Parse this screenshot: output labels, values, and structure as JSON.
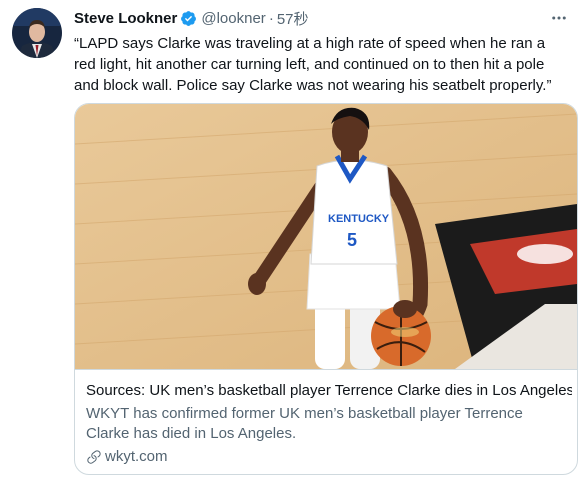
{
  "tweet": {
    "author": {
      "name": "Steve Lookner",
      "handle": "@lookner",
      "verified": true
    },
    "separator": "·",
    "time": "57秒",
    "text": "“LAPD says Clarke was traveling at a high rate of speed when he ran a red light, hit another car turning left, and continued on to then hit a pole and block wall. Police say Clarke was not wearing his seatbelt properly.”",
    "card": {
      "title": "Sources: UK men’s basketball player Terrence Clarke dies in Los Angeles",
      "description": "WKYT has confirmed former UK men’s basketball player Terrence Clarke has died in Los Angeles.",
      "domain": "wkyt.com",
      "jersey_text": "KENTUCKY",
      "jersey_number": "5"
    }
  },
  "colors": {
    "accent": "#1d9bf0",
    "secondary_text": "#536471",
    "border": "#cfd9de"
  },
  "icons": [
    "verified-badge-icon",
    "more-icon",
    "link-icon"
  ]
}
